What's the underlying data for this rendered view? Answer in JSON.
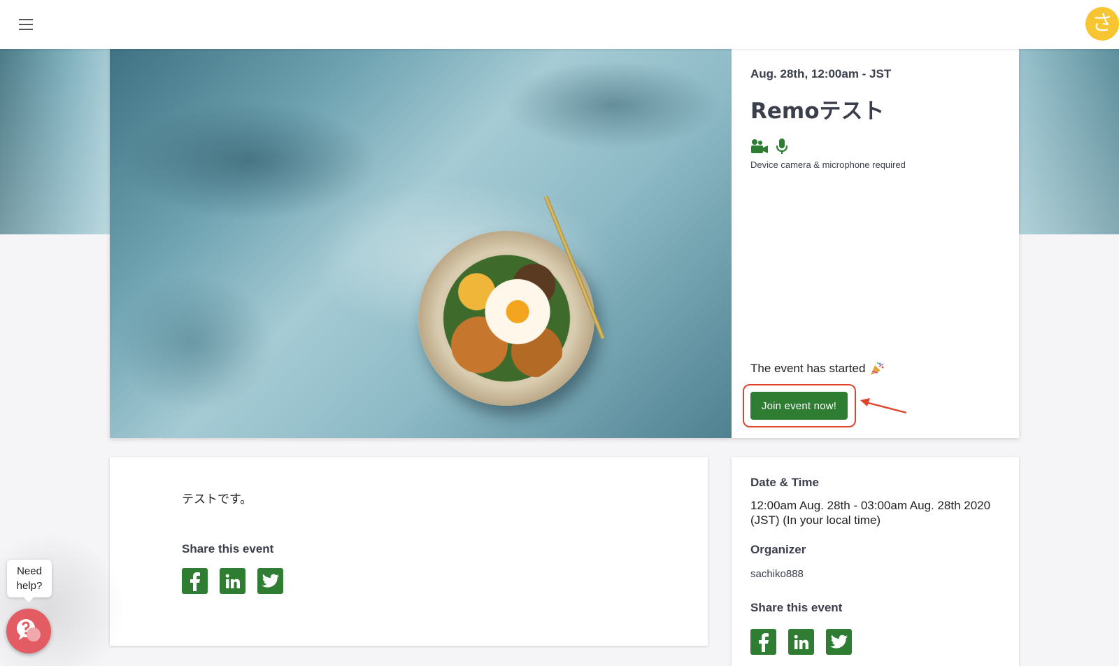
{
  "appbar": {
    "menu_icon": "hamburger-menu-icon",
    "avatar_letter": "さ",
    "avatar_color": "#f7c531"
  },
  "event": {
    "date_line": "Aug. 28th, 12:00am - JST",
    "title": "Remoテスト",
    "device_icons": [
      "video-camera-icon",
      "microphone-icon"
    ],
    "device_note": "Device camera & microphone required",
    "status_text": "The event has started",
    "status_icon": "party-popper-icon",
    "join_label": "Join event now!",
    "accent_color": "#2e7d32",
    "highlight_color": "#e0442d"
  },
  "description": {
    "text": "テストです。",
    "share_heading": "Share this event",
    "share_icons": [
      "facebook-icon",
      "linkedin-icon",
      "twitter-icon"
    ]
  },
  "details": {
    "datetime_heading": "Date & Time",
    "datetime_value": "12:00am Aug. 28th - 03:00am Aug. 28th 2020 (JST) (In your local time)",
    "organizer_heading": "Organizer",
    "organizer_name": "sachiko888",
    "share_heading": "Share this event",
    "share_icons": [
      "facebook-icon",
      "linkedin-icon",
      "twitter-icon"
    ]
  },
  "help_widget": {
    "bubble_text": "Need help?",
    "icon": "help-chat-icon",
    "color": "#e35c64"
  }
}
